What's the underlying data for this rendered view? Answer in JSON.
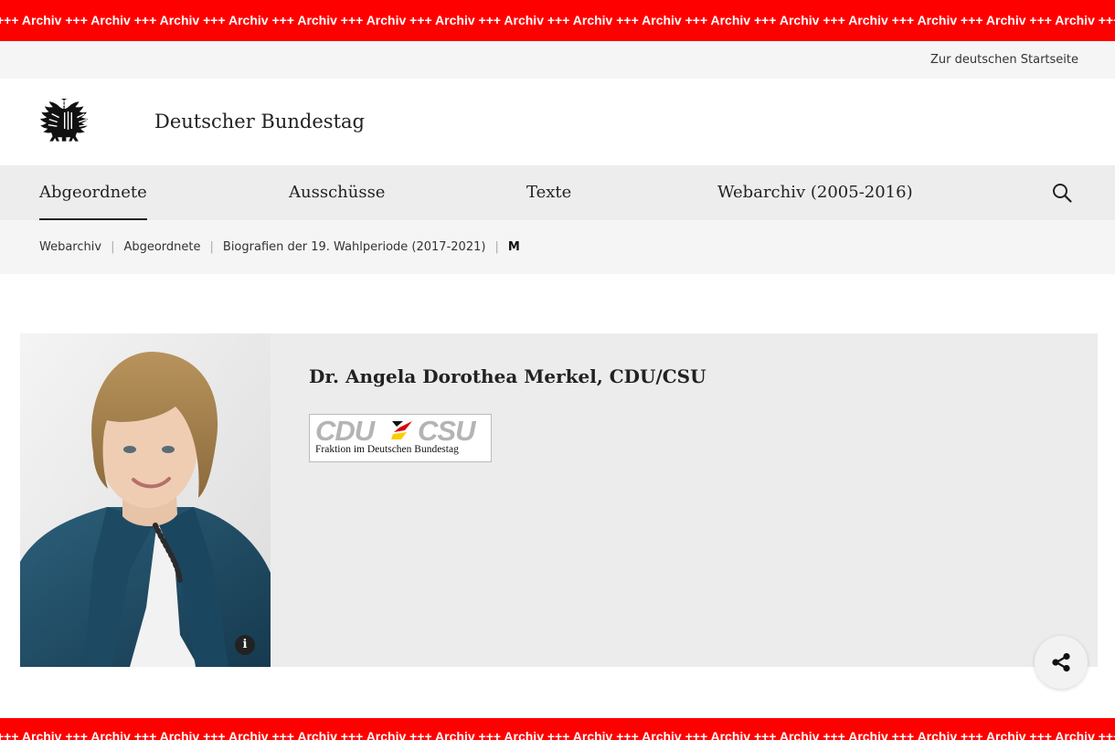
{
  "archive_banner": {
    "text": "+++ Archiv +++ Archiv +++ Archiv +++ Archiv +++ Archiv +++ Archiv +++ Archiv +++ Archiv +++ Archiv +++ Archiv +++ Archiv +++ Archiv +++ Archiv +++ Archiv +++ Archiv +++ Archiv +++ Archiv +++ Archiv +++ Archiv"
  },
  "utility": {
    "home_link": "Zur deutschen Startseite"
  },
  "brand": {
    "title": "Deutscher Bundestag",
    "logo_icon": "federal-eagle-icon"
  },
  "nav": {
    "items": [
      {
        "label": "Abgeordnete",
        "active": true
      },
      {
        "label": "Ausschüsse",
        "active": false
      },
      {
        "label": "Texte",
        "active": false
      },
      {
        "label": "Webarchiv (2005-2016)",
        "active": false
      }
    ],
    "search_icon": "search-icon"
  },
  "breadcrumb": {
    "items": [
      "Webarchiv",
      "Abgeordnete",
      "Biografien der 19. Wahlperiode (2017-2021)"
    ],
    "current": "M"
  },
  "profile": {
    "name": "Dr. Angela Dorothea Merkel, CDU/CSU",
    "info_icon": "info-icon",
    "info_label": "i",
    "party_logo": {
      "word_left": "CDU",
      "word_right": "CSU",
      "subtitle": "Fraktion im Deutschen Bundestag"
    }
  },
  "share": {
    "icon": "share-icon"
  },
  "colors": {
    "archive_red": "#ff0000",
    "nav_bg": "#ededed",
    "light_bg": "#f5f5f5",
    "card_bg": "#ececec"
  }
}
